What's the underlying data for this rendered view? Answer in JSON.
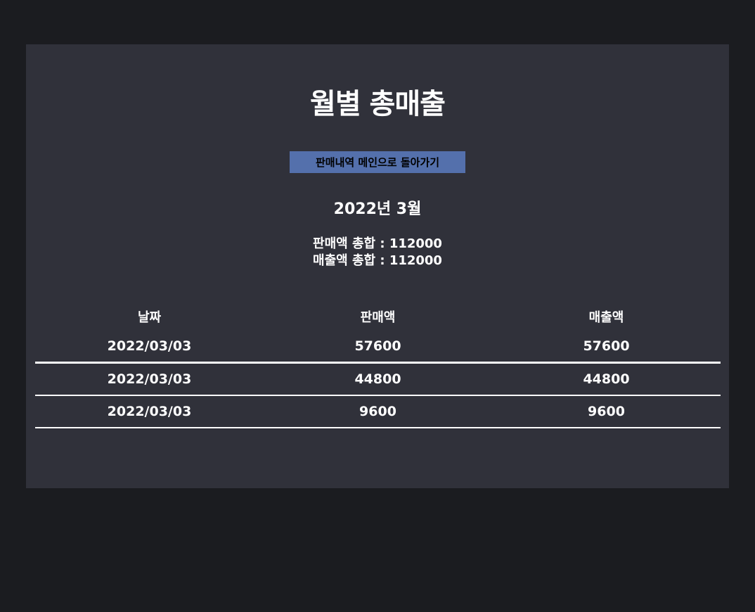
{
  "page": {
    "title": "월별 총매출",
    "back_button_label": "판매내역 메인으로 돌아가기",
    "period": "2022년 3월",
    "totals": {
      "sales_total": "판매액 총합 : 112000",
      "revenue_total": "매출액 총합 : 112000"
    }
  },
  "table": {
    "headers": [
      "날짜",
      "판매액",
      "매출액"
    ],
    "rows": [
      [
        "2022/03/03",
        "57600",
        "57600"
      ],
      [
        "2022/03/03",
        "44800",
        "44800"
      ],
      [
        "2022/03/03",
        "9600",
        "9600"
      ]
    ]
  }
}
